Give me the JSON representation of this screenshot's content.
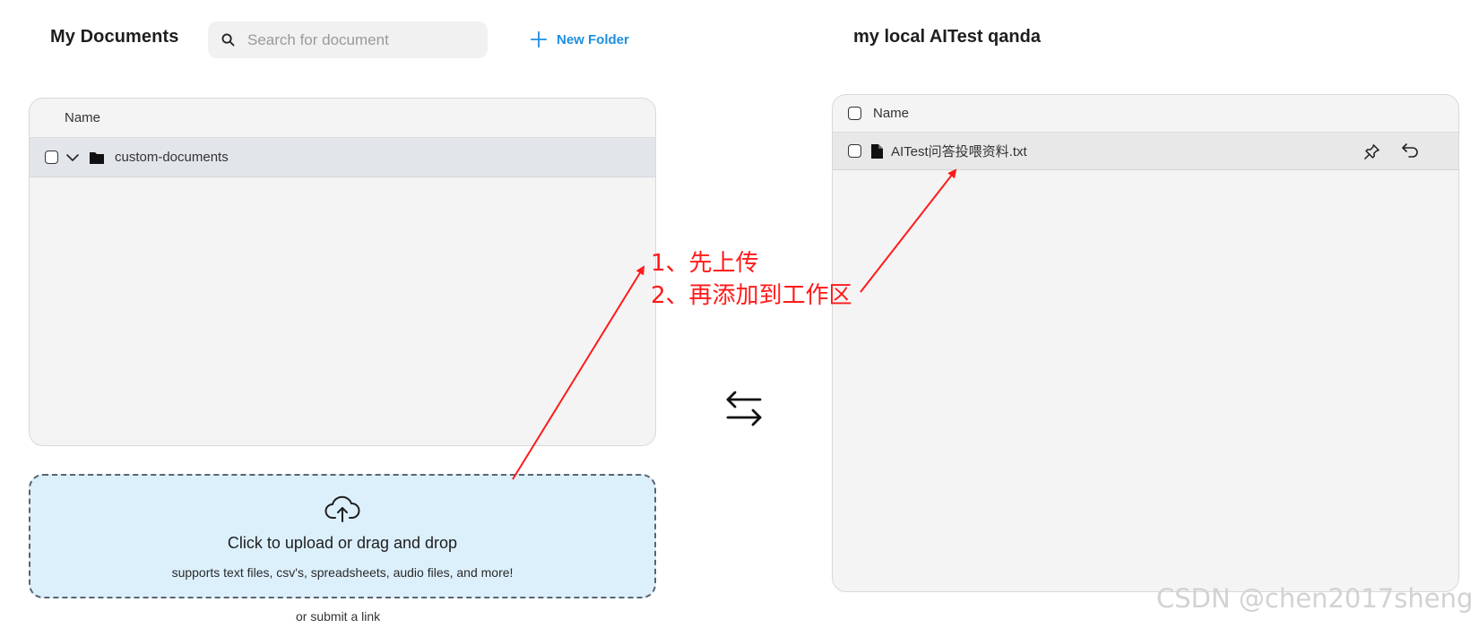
{
  "left": {
    "title": "My Documents",
    "search_placeholder": "Search for document",
    "new_folder_label": "New Folder",
    "table_header": "Name",
    "rows": [
      {
        "name": "custom-documents"
      }
    ],
    "upload": {
      "title": "Click to upload or drag and drop",
      "subtitle": "supports text files, csv's, spreadsheets, audio files, and more!"
    },
    "submit_link": "or submit a link"
  },
  "right": {
    "title": "my local AITest qanda",
    "table_header": "Name",
    "rows": [
      {
        "name": "AITest问答投喂资料.txt"
      }
    ]
  },
  "annotation": {
    "line1": "1、先上传",
    "line2": "2、再添加到工作区",
    "color": "#ff1a1a"
  },
  "icons": {
    "search": "search-icon",
    "new_folder": "plus-icon",
    "expand": "chevron-down-icon",
    "folder": "folder-icon",
    "upload": "cloud-upload-icon",
    "swap": "swap-arrows-icon",
    "file": "file-icon",
    "pin": "pin-icon",
    "undo": "undo-icon"
  },
  "accent_color": "#1d8fe0",
  "upload_bg_color": "#dcf0fc",
  "watermark": "CSDN @chen2017sheng"
}
